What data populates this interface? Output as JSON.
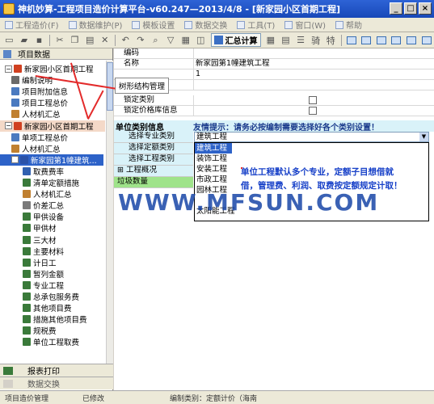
{
  "window": {
    "title": "神机妙算-工程项目造价计算平台-v60.247—2013/4/8 - [新家园小区首期工程]",
    "buttons": [
      "_",
      "□",
      "×"
    ]
  },
  "menu": [
    {
      "label": "工程造价(F)"
    },
    {
      "label": "数据维护(P)"
    },
    {
      "label": "模板设置"
    },
    {
      "label": "数据交换"
    },
    {
      "label": "工具(T)"
    },
    {
      "label": "窗口(W)"
    },
    {
      "label": "帮助"
    }
  ],
  "toolbar": {
    "calc_label": "汇总计算",
    "glyph_qi": "骑",
    "glyph_te": "特"
  },
  "left": {
    "header": "项目数据",
    "footer_report": "报表打印",
    "footer_exchange": "数据交换",
    "tree": [
      {
        "label": "新家园小区首期工程",
        "level": 0,
        "icon": "project-icon",
        "color": "#d04020"
      },
      {
        "label": "编制说明",
        "level": 1,
        "icon": "doc-icon",
        "color": "#6a6a6a"
      },
      {
        "label": "项目附加信息",
        "level": 1,
        "icon": "info-icon",
        "color": "#4a7ac0"
      },
      {
        "label": "项目工程总价",
        "level": 1,
        "icon": "price-icon",
        "color": "#4a7ac0"
      },
      {
        "label": "人材机汇总",
        "level": 1,
        "icon": "material-icon",
        "color": "#c08030"
      },
      {
        "label": "新家园小区首期工程",
        "level": 0,
        "icon": "project-icon",
        "color": "#d04020"
      },
      {
        "label": "单项工程总价",
        "level": 1,
        "icon": "price-icon",
        "color": "#4a7ac0"
      },
      {
        "label": "人材机汇总",
        "level": 1,
        "icon": "material-icon",
        "color": "#c08030"
      },
      {
        "label": "新家园第1幢建筑...",
        "level": 1,
        "icon": "building-icon",
        "color": "#2a52a8"
      },
      {
        "label": "取费费率",
        "level": 2,
        "icon": "rate-icon",
        "color": "#3060b0"
      },
      {
        "label": "清单定额措施",
        "level": 2,
        "icon": "list-icon",
        "color": "#3a7a3a"
      },
      {
        "label": "人材机汇总",
        "level": 2,
        "icon": "material-icon",
        "color": "#c08030"
      },
      {
        "label": "价差汇总",
        "level": 2,
        "icon": "diff-icon",
        "color": "#7a7a7a"
      },
      {
        "label": "甲供设备",
        "level": 2,
        "icon": "equip-icon",
        "color": "#3a7a3a"
      },
      {
        "label": "甲供材",
        "level": 2,
        "icon": "supply-icon",
        "color": "#3a7a3a"
      },
      {
        "label": "三大材",
        "level": 2,
        "icon": "three-icon",
        "color": "#3a7a3a"
      },
      {
        "label": "主要材料",
        "level": 2,
        "icon": "main-icon",
        "color": "#3a7a3a"
      },
      {
        "label": "计日工",
        "level": 2,
        "icon": "day-icon",
        "color": "#3a7a3a"
      },
      {
        "label": "暂列金额",
        "level": 2,
        "icon": "temp-icon",
        "color": "#3a7a3a"
      },
      {
        "label": "专业工程",
        "level": 2,
        "icon": "pro-icon",
        "color": "#3a7a3a"
      },
      {
        "label": "总承包服务费",
        "level": 2,
        "icon": "service-icon",
        "color": "#3a7a3a"
      },
      {
        "label": "其他项目费",
        "level": 2,
        "icon": "other-icon",
        "color": "#3a7a3a"
      },
      {
        "label": "措施其他项目费",
        "level": 2,
        "icon": "measure-icon",
        "color": "#3a7a3a"
      },
      {
        "label": "规税费",
        "level": 2,
        "icon": "tax-icon",
        "color": "#3a7a3a"
      },
      {
        "label": "单位工程取费",
        "level": 2,
        "icon": "fee-icon",
        "color": "#3a7a3a"
      }
    ]
  },
  "grid": {
    "rows": [
      {
        "label": "编码",
        "value": ""
      },
      {
        "label": "名称",
        "value": "新家园第1幢建筑工程"
      },
      {
        "label": "",
        "value": "1"
      },
      {
        "label": "",
        "value": ""
      },
      {
        "label": "锁定类别",
        "value": ""
      },
      {
        "label": "锁定价格库信息",
        "value": ""
      }
    ],
    "info_label": "单位类别信息",
    "info_tip": "友情提示：请务必按编制需要选择好各个类别设置！",
    "categories": [
      {
        "label": "选择专业类别",
        "value": "建筑工程"
      },
      {
        "label": "选择定额类别",
        "value": ""
      },
      {
        "label": "选择工程类别",
        "value": ""
      },
      {
        "label": "工程概况",
        "value": ""
      },
      {
        "label": "垃圾数量",
        "value": ""
      }
    ],
    "dropdown_options": [
      "建筑工程",
      "装饰工程",
      "安装工程",
      "市政工程",
      "园林工程",
      "",
      "太阳能工程"
    ]
  },
  "annotations": {
    "tree_note": "树形结构管理",
    "red_note": "单位工程默认多个专业，定额子目想借就借，管理费、利润、取费按定额规定计取！",
    "watermark": "WWW.MFSUN.COM"
  },
  "status": {
    "left": "项目造价管理",
    "modified": "已修改",
    "norm": "编制类别：定额计价（海南",
    "right": "  "
  }
}
